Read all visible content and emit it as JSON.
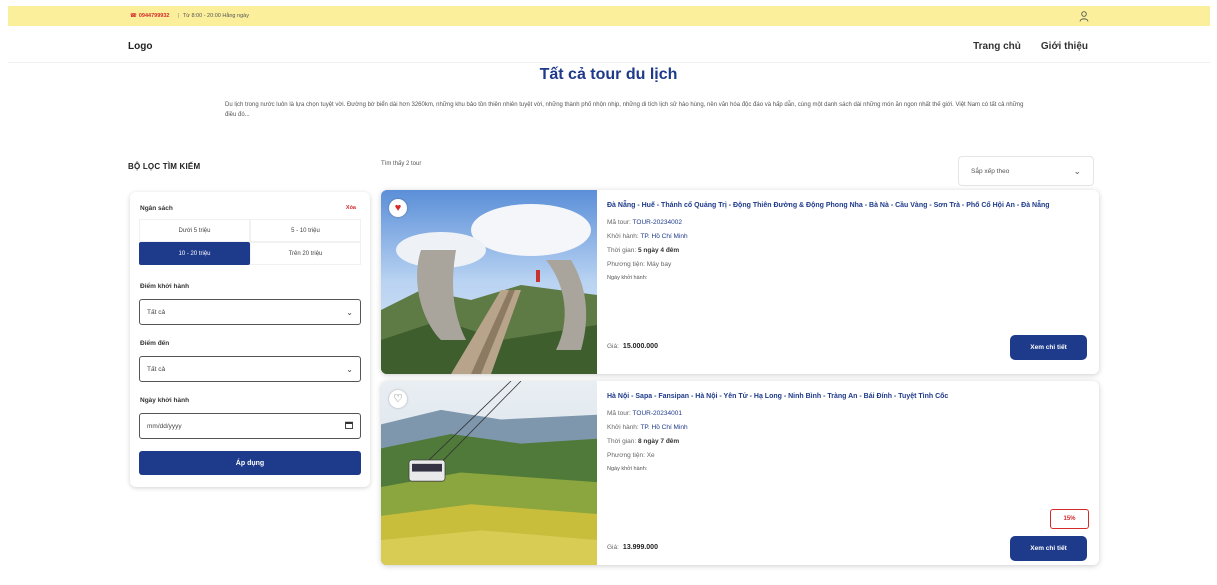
{
  "topbar": {
    "phone": "0944799932",
    "hours": "Từ 8:00 - 20:00 Hằng ngày"
  },
  "header": {
    "logo": "Logo",
    "nav": [
      "Trang chủ",
      "Giới thiệu"
    ]
  },
  "page": {
    "title": "Tất cả tour du lịch",
    "intro": "Du lịch trong nước luôn là lựa chọn tuyệt vời. Đường bờ biển dài hơn 3260km, những khu bảo tồn thiên nhiên tuyệt vời, những thành phố nhộn nhịp, những di tích lịch sử hào hùng, nền văn hóa độc đáo và hấp dẫn, cùng một danh sách dài những món ăn ngon nhất thế giới. Việt Nam có tất cả những điều đó..."
  },
  "filter": {
    "title": "BỘ LỌC TÌM KIẾM",
    "budget_label": "Ngân sách",
    "clear_label": "Xóa",
    "budget_options": [
      "Dưới 5 triệu",
      "5 - 10 triệu",
      "10 - 20 triệu",
      "Trên 20 triệu"
    ],
    "budget_selected": "10 - 20 triệu",
    "departure_label": "Điểm khởi hành",
    "departure_value": "Tất cả",
    "destination_label": "Điểm đến",
    "destination_value": "Tất cả",
    "date_label": "Ngày khởi hành",
    "date_placeholder": "mm/dd/yyyy",
    "apply_label": "Áp dụng"
  },
  "results": {
    "found_text": "Tìm thấy 2 tour",
    "sort_label": "Sắp xếp theo"
  },
  "tours": [
    {
      "name": "Đà Nẵng - Huế - Thánh cổ Quảng Trị - Động Thiên Đường & Động Phong Nha - Bà Nà - Cầu Vàng - Sơn Trà - Phố Cổ Hội An - Đà Nẵng",
      "code_label": "Mã tour:",
      "code": "TOUR-20234002",
      "depart_label": "Khởi hành:",
      "depart": "TP. Hồ Chí Minh",
      "time_label": "Thời gian:",
      "time": "5 ngày 4 đêm",
      "transport_label": "Phương tiện:",
      "transport": "Máy bay",
      "date_label": "Ngày khởi hành:",
      "price_label": "Giá:",
      "price": "15.000.000",
      "detail_label": "Xem chi tiết",
      "favorite": true
    },
    {
      "name": "Hà Nội - Sapa - Fansipan - Hà Nội - Yên Tử - Hạ Long - Ninh Bình - Tràng An - Bái Đính - Tuyệt Tình Cốc",
      "code_label": "Mã tour:",
      "code": "TOUR-20234001",
      "depart_label": "Khởi hành:",
      "depart": "TP. Hồ Chí Minh",
      "time_label": "Thời gian:",
      "time": "8 ngày 7 đêm",
      "transport_label": "Phương tiện:",
      "transport": "Xe",
      "date_label": "Ngày khởi hành:",
      "price_label": "Giá:",
      "price": "13.999.000",
      "detail_label": "Xem chi tiết",
      "tag": "15%",
      "favorite": false
    }
  ],
  "colors": {
    "topbar_bg": "#fbef9c",
    "primary": "#1e3a8a",
    "accent_red": "#d52a2a"
  }
}
